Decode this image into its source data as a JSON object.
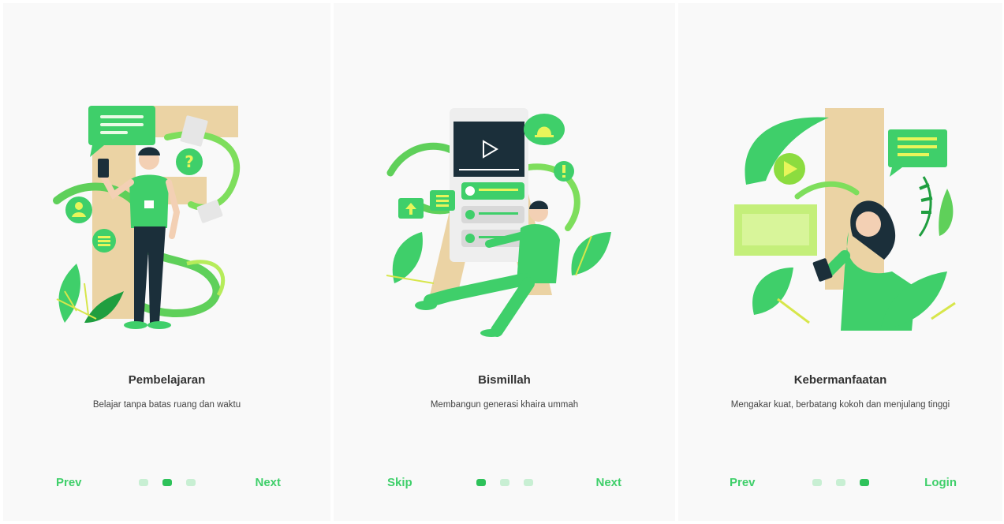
{
  "colors": {
    "accent": "#3fcf6a",
    "dot_active": "#2ec25a",
    "dot_inactive": "#c8efd3",
    "tan": "#ebd3a4",
    "green_dark": "#1f9e3f",
    "navy": "#1b2f3a"
  },
  "screens": [
    {
      "title": "Pembelajaran",
      "subtitle": "Belajar tanpa batas ruang dan waktu",
      "left_button": "Prev",
      "right_button": "Next",
      "active_dot": 1,
      "illustration_icons": [
        "chat-bubble-icon",
        "question-icon",
        "user-icon",
        "list-icon",
        "phone-icon",
        "plant-icon"
      ]
    },
    {
      "title": "Bismillah",
      "subtitle": "Membangun generasi khaira ummah",
      "left_button": "Skip",
      "right_button": "Next",
      "active_dot": 0,
      "illustration_icons": [
        "play-icon",
        "bell-icon",
        "exclamation-icon",
        "upload-icon",
        "list-icon",
        "plant-icon"
      ]
    },
    {
      "title": "Kebermanfaatan",
      "subtitle": "Mengakar kuat, berbatang kokoh dan menjulang tinggi",
      "left_button": "Prev",
      "right_button": "Login",
      "active_dot": 2,
      "illustration_icons": [
        "play-icon",
        "chat-bubble-icon",
        "monitor-icon",
        "phone-icon",
        "plant-icon"
      ]
    }
  ]
}
